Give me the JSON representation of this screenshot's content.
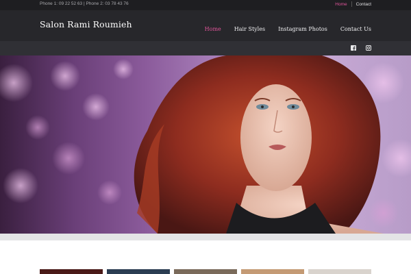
{
  "topbar": {
    "phones": "Phone 1: 09 22 52 63 | Phone 2: 03 78 43 76",
    "links": [
      {
        "label": "Home",
        "active": true
      },
      {
        "label": "Contact",
        "active": false
      }
    ]
  },
  "header": {
    "brand": "Salon Rami Roumieh",
    "nav": [
      {
        "label": "Home",
        "active": true
      },
      {
        "label": "Hair Styles",
        "active": false
      },
      {
        "label": "Instagram Photos",
        "active": false
      },
      {
        "label": "Contact Us",
        "active": false
      }
    ]
  },
  "social": {
    "icons": [
      "facebook-icon",
      "instagram-icon"
    ]
  },
  "colors": {
    "accent": "#e0559a",
    "topbar_bg": "#1e1e21",
    "header_bg": "#27272b",
    "socialbar_bg": "#303035"
  },
  "hero": {
    "image": "hero-photo-red-haired-model-purple-bokeh"
  },
  "gallery": {
    "thumbnails": [
      "thumb-1",
      "thumb-2",
      "thumb-3",
      "thumb-4",
      "thumb-5"
    ]
  }
}
